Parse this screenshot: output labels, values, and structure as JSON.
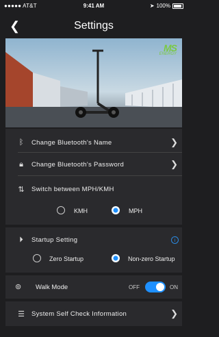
{
  "status_bar": {
    "carrier": "●●●●● AT&T",
    "time": "9:41 AM",
    "battery": "100%"
  },
  "nav": {
    "title": "Settings"
  },
  "hero": {
    "logo_top": "MS",
    "logo_bottom": "ENERGY"
  },
  "settings": {
    "bluetooth_name": "Change Bluetooth's Name",
    "bluetooth_password": "Change Bluetooth's Password",
    "switch_units": "Switch between MPH/KMH",
    "unit_kmh": "KMH",
    "unit_mph": "MPH",
    "startup_setting": "Startup Setting",
    "zero_startup": "Zero Startup",
    "nonzero_startup": "Non-zero Startup",
    "walk_mode": "Walk Mode",
    "off": "OFF",
    "on": "ON",
    "self_check": "System Self Check Information"
  }
}
